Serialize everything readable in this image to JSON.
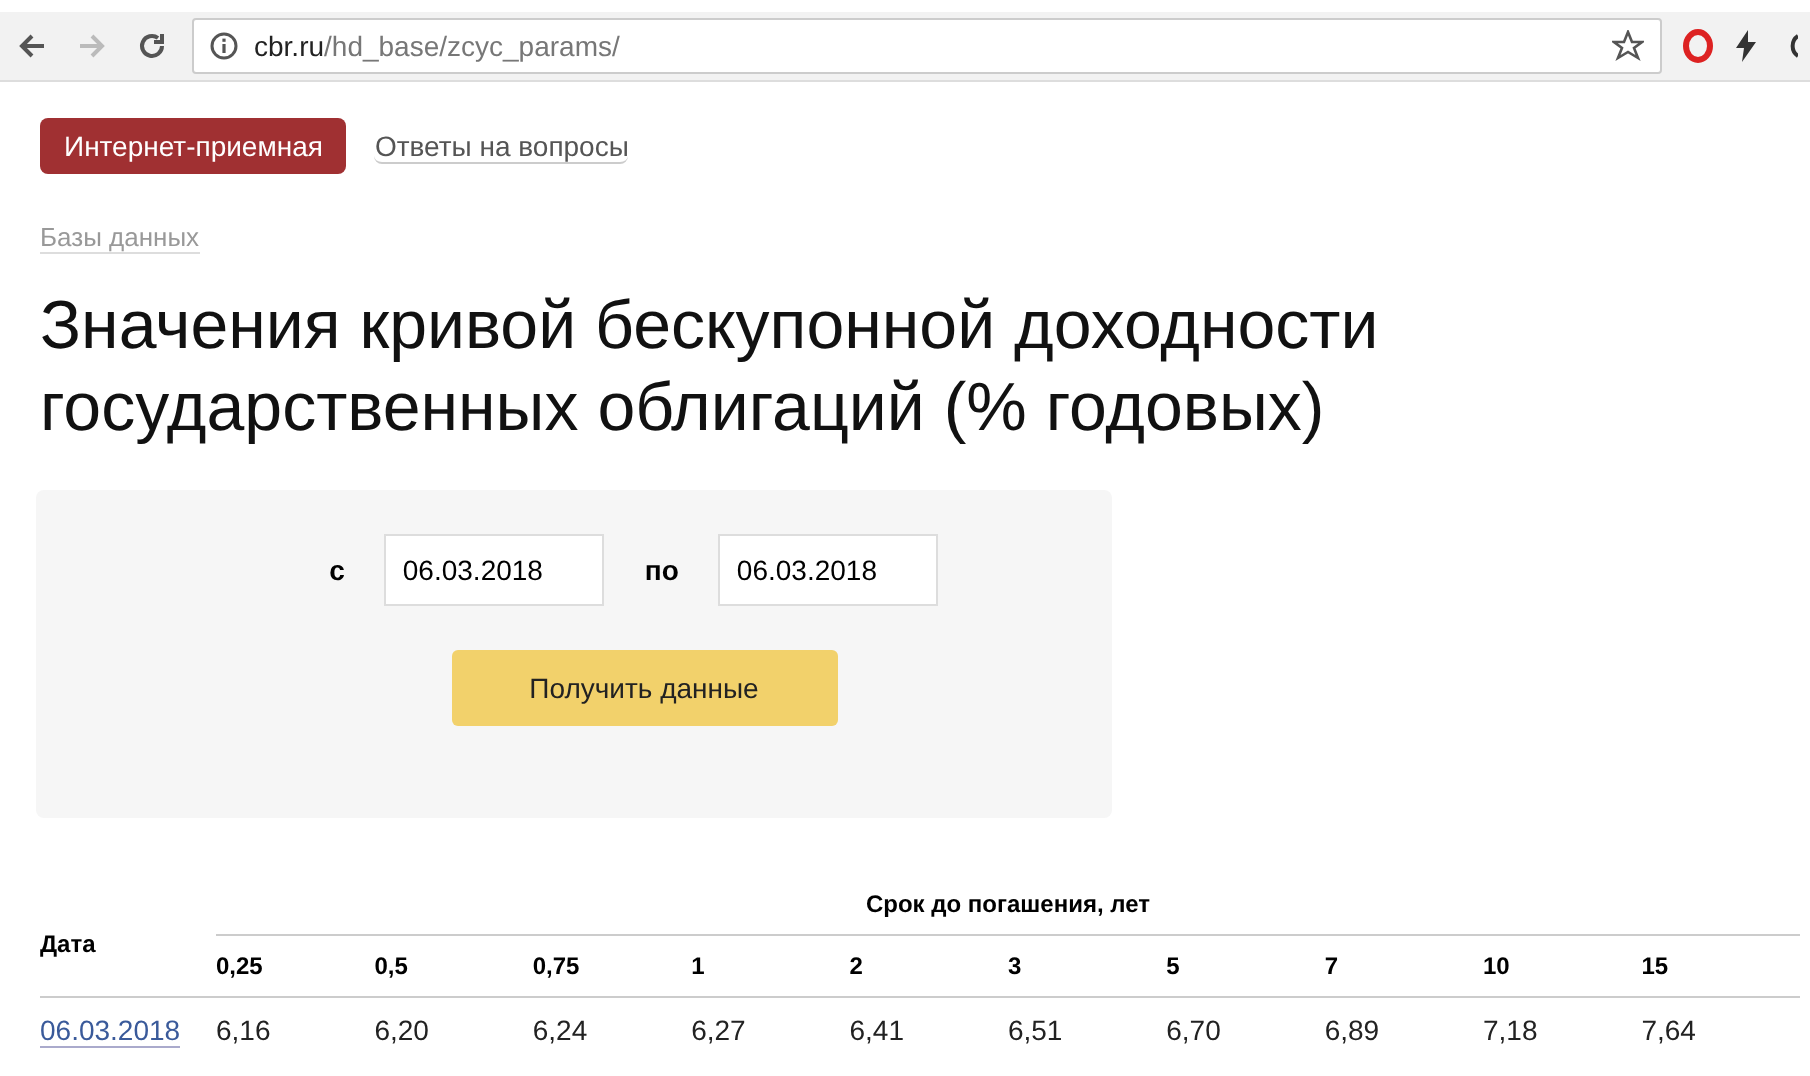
{
  "browser": {
    "url_host": "cbr.ru",
    "url_path": "/hd_base/zcyc_params/"
  },
  "nav": [
    {
      "label": "Интернет-приемная",
      "selected": true
    },
    {
      "label": "Ответы на вопросы",
      "selected": false
    }
  ],
  "breadcrumb": "Базы данных",
  "title": "Значения кривой бескупонной доходности государственных облигаций (% годовых)",
  "form": {
    "from_label": "с",
    "from_value": "06.03.2018",
    "to_label": "по",
    "to_value": "06.03.2018",
    "submit": "Получить данные"
  },
  "table": {
    "date_column": "Дата",
    "group_heading": "Срок до погашения, лет",
    "columns": [
      "0,25",
      "0,5",
      "0,75",
      "1",
      "2",
      "3",
      "5",
      "7",
      "10",
      "15"
    ],
    "rows": [
      {
        "date": "06.03.2018",
        "values": [
          "6,16",
          "6,20",
          "6,24",
          "6,27",
          "6,41",
          "6,51",
          "6,70",
          "6,89",
          "7,18",
          "7,64"
        ]
      }
    ]
  }
}
